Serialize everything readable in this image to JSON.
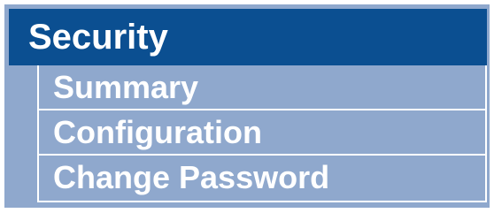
{
  "panel": {
    "title": "Security",
    "items": [
      {
        "label": "Summary"
      },
      {
        "label": "Configuration"
      },
      {
        "label": "Change Password"
      }
    ]
  },
  "colors": {
    "header_background": "#0b4f91",
    "panel_background": "#8fa8cd",
    "text": "#ffffff",
    "divider": "#ffffff"
  }
}
